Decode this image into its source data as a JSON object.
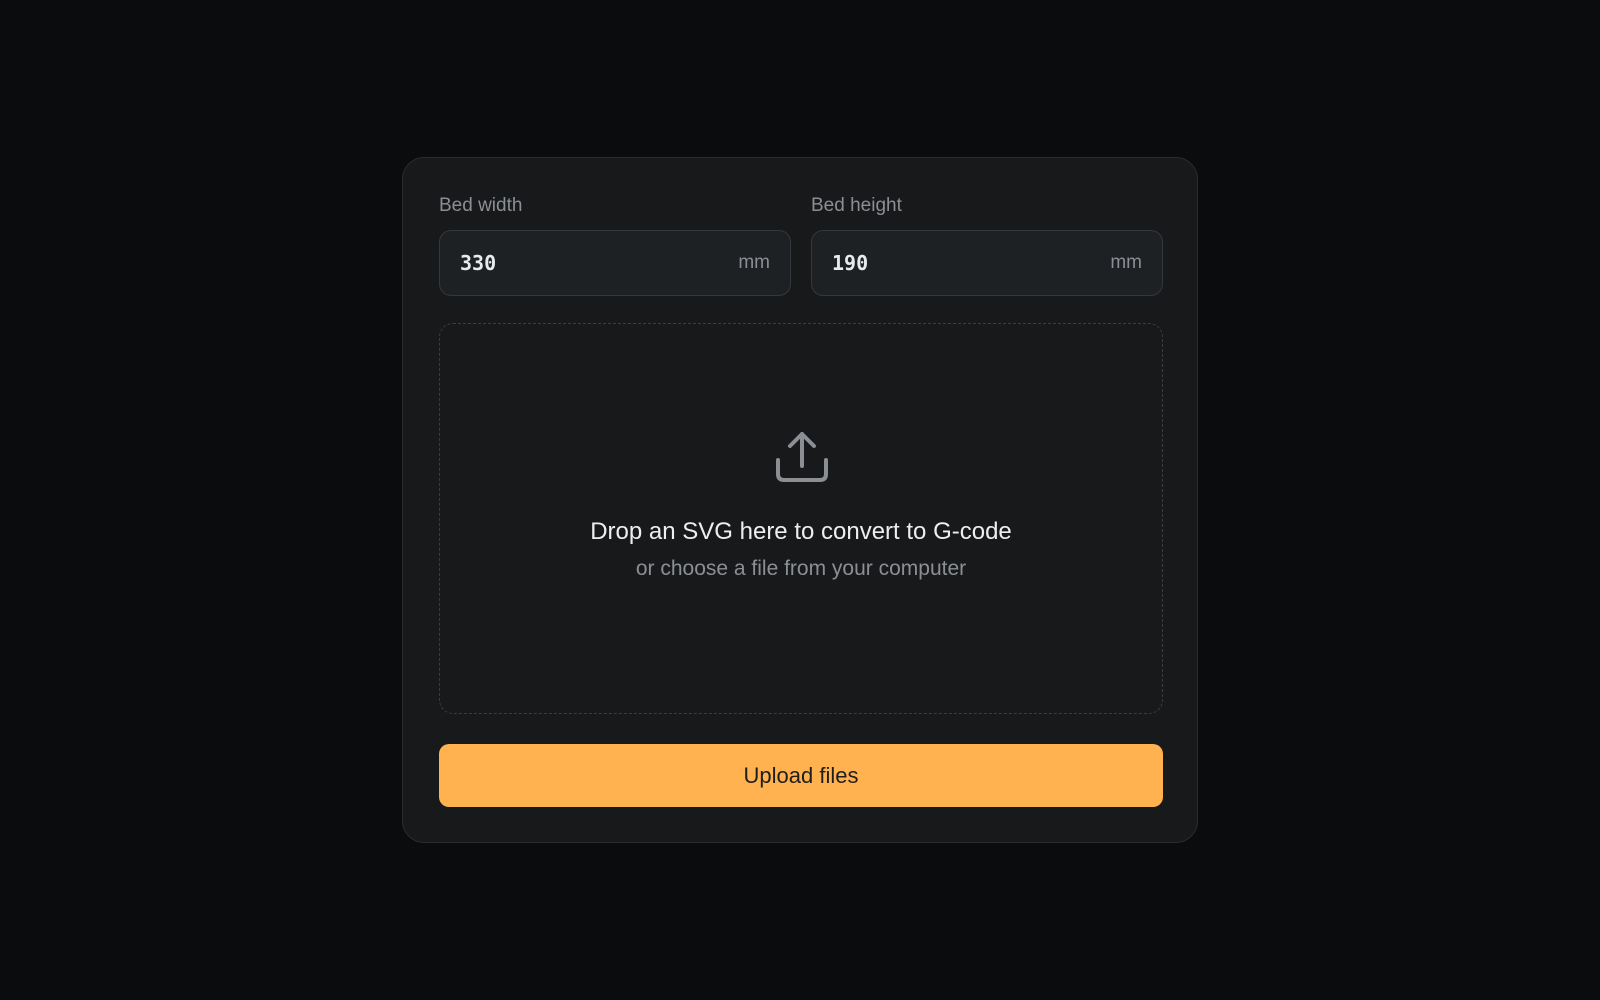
{
  "bed": {
    "width": {
      "label": "Bed width",
      "value": "330",
      "unit": "mm"
    },
    "height": {
      "label": "Bed height",
      "value": "190",
      "unit": "mm"
    }
  },
  "dropzone": {
    "icon": "upload-icon",
    "title": "Drop an SVG here to convert to G-code",
    "subtitle": "or choose a file from your computer"
  },
  "actions": {
    "upload_label": "Upload files"
  },
  "colors": {
    "accent": "#ffb24f",
    "background": "#0a0c0e",
    "card": "#17191b"
  }
}
